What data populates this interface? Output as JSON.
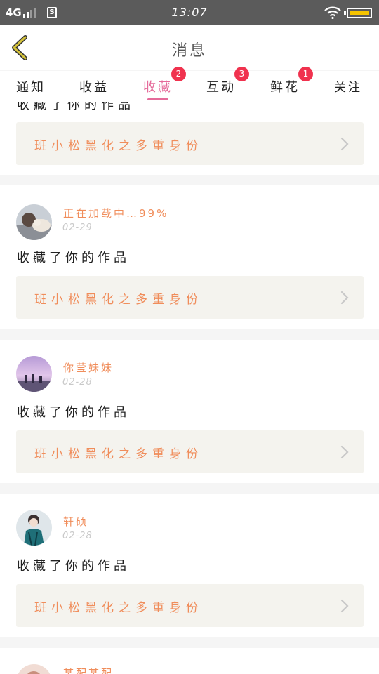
{
  "status_bar": {
    "network": "4G",
    "sim_label": "S",
    "time": "13:07",
    "battery_color": "#f5c400"
  },
  "header": {
    "title": "消息",
    "back_icon": "chevron-left-icon",
    "back_color": "#d4c23a"
  },
  "tabs": [
    {
      "label": "通知",
      "badge": "",
      "active": false
    },
    {
      "label": "收益",
      "badge": "",
      "active": false
    },
    {
      "label": "收藏",
      "badge": "2",
      "active": true
    },
    {
      "label": "互动",
      "badge": "3",
      "active": false
    },
    {
      "label": "鲜花",
      "badge": "1",
      "active": false
    },
    {
      "label": "关注",
      "badge": "",
      "active": false
    }
  ],
  "accent_color": "#e56a9a",
  "badge_color": "#f0324e",
  "feed": {
    "partial_top": {
      "action_text": "收藏了你的作品",
      "work_title": "班小松黑化之多重身份"
    },
    "items": [
      {
        "user": "正在加载中…99%",
        "date": "02-29",
        "action": "收藏了你的作品",
        "work_title": "班小松黑化之多重身份"
      },
      {
        "user": "你莹妹妹",
        "date": "02-28",
        "action": "收藏了你的作品",
        "work_title": "班小松黑化之多重身份"
      },
      {
        "user": "轩硕",
        "date": "02-28",
        "action": "收藏了你的作品",
        "work_title": "班小松黑化之多重身份"
      },
      {
        "user": "某配某配",
        "date": "",
        "action": "",
        "work_title": ""
      }
    ]
  }
}
